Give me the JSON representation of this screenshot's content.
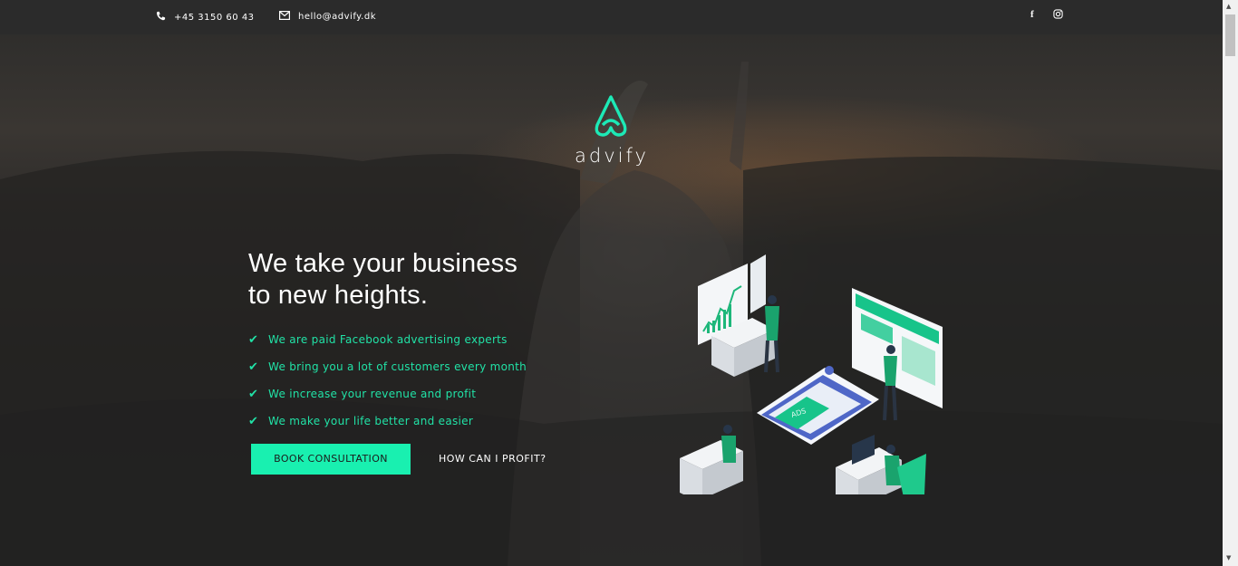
{
  "topbar": {
    "phone": "+45 3150 60 43",
    "email": "hello@advify.dk",
    "phone_icon": "phone-icon",
    "email_icon": "envelope-icon",
    "social": [
      {
        "name": "facebook-icon",
        "glyph": "f"
      },
      {
        "name": "instagram-icon",
        "glyph": "◎"
      }
    ]
  },
  "brand": {
    "name": "advify",
    "accent": "#1de9b6"
  },
  "hero": {
    "headline_line1": "We take your business",
    "headline_line2": "to new heights.",
    "features": [
      "We are paid Facebook advertising experts",
      "We bring you a lot of customers every month",
      "We increase your revenue and profit",
      "We make your life better and easier"
    ],
    "cta_primary": "BOOK CONSULTATION",
    "cta_secondary": "HOW CAN I PROFIT?",
    "illustration_ads_label": "ADS"
  }
}
